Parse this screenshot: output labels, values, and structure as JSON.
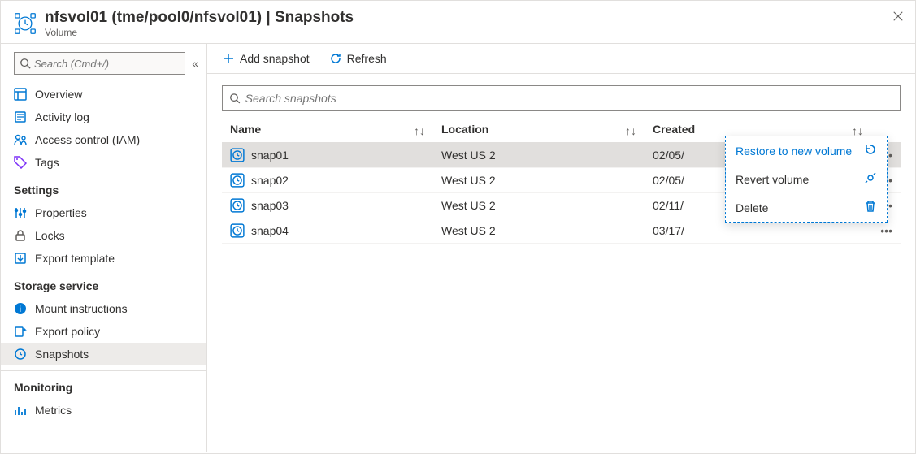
{
  "header": {
    "title": "nfsvol01 (tme/pool0/nfsvol01) | Snapshots",
    "subtitle": "Volume"
  },
  "sidebar": {
    "search_placeholder": "Search (Cmd+/)",
    "items_top": [
      {
        "label": "Overview",
        "icon": "overview"
      },
      {
        "label": "Activity log",
        "icon": "activity"
      },
      {
        "label": "Access control (IAM)",
        "icon": "iam"
      },
      {
        "label": "Tags",
        "icon": "tags"
      }
    ],
    "groups": [
      {
        "title": "Settings",
        "items": [
          {
            "label": "Properties",
            "icon": "properties"
          },
          {
            "label": "Locks",
            "icon": "locks"
          },
          {
            "label": "Export template",
            "icon": "export-template"
          }
        ]
      },
      {
        "title": "Storage service",
        "items": [
          {
            "label": "Mount instructions",
            "icon": "mount"
          },
          {
            "label": "Export policy",
            "icon": "export-policy"
          },
          {
            "label": "Snapshots",
            "icon": "snapshots",
            "selected": true
          }
        ]
      },
      {
        "title": "Monitoring",
        "items": [
          {
            "label": "Metrics",
            "icon": "metrics"
          }
        ]
      }
    ]
  },
  "toolbar": {
    "add_label": "Add snapshot",
    "refresh_label": "Refresh"
  },
  "snapshots": {
    "search_placeholder": "Search snapshots",
    "columns": {
      "name": "Name",
      "location": "Location",
      "created": "Created"
    },
    "rows": [
      {
        "name": "snap01",
        "location": "West US 2",
        "created": "02/05/"
      },
      {
        "name": "snap02",
        "location": "West US 2",
        "created": "02/05/"
      },
      {
        "name": "snap03",
        "location": "West US 2",
        "created": "02/11/"
      },
      {
        "name": "snap04",
        "location": "West US 2",
        "created": "03/17/"
      }
    ]
  },
  "context_menu": {
    "restore": "Restore to new volume",
    "revert": "Revert volume",
    "delete": "Delete"
  }
}
